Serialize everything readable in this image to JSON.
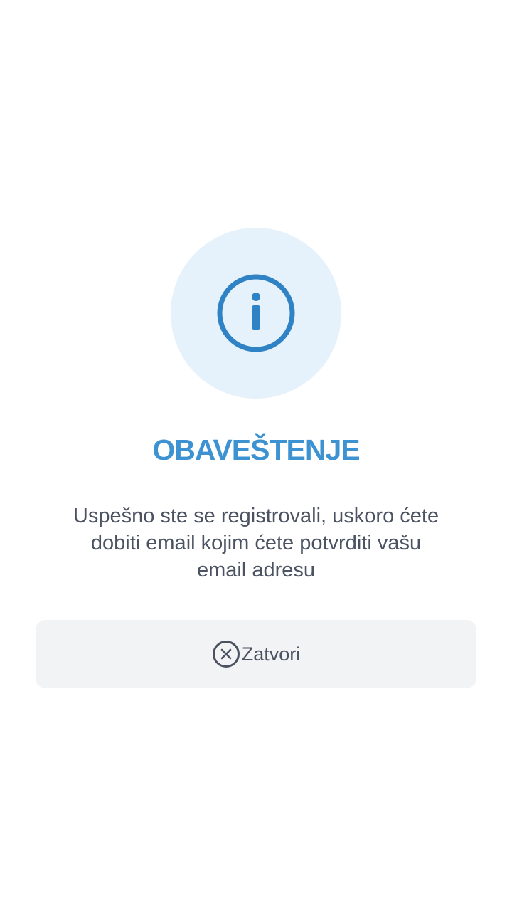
{
  "dialog": {
    "icon": "info-icon",
    "title": "OBAVEŠTENJE",
    "message": "Uspešno ste se registrovali, uskoro ćete dobiti email kojim ćete potvrditi vašu email adresu",
    "close_button": {
      "label": "Zatvori",
      "icon": "close-circle-icon"
    }
  },
  "colors": {
    "accent": "#3d92d2",
    "icon_stroke": "#2f82c4",
    "icon_background": "#e6f2fb",
    "text": "#4b5262",
    "button_background": "#f2f3f5"
  }
}
